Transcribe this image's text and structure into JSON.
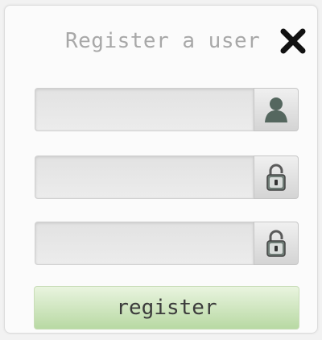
{
  "dialog": {
    "title": "Register a user",
    "close_icon": "close-icon"
  },
  "fields": {
    "username": {
      "value": "",
      "placeholder": "",
      "icon": "user-icon"
    },
    "password": {
      "value": "",
      "placeholder": "",
      "icon": "lock-icon"
    },
    "confirm_password": {
      "value": "",
      "placeholder": "",
      "icon": "lock-icon"
    }
  },
  "actions": {
    "register_label": "register"
  },
  "colors": {
    "title": "#a8a8a8",
    "button_top": "#e9f4df",
    "button_bottom": "#b8d9a3",
    "icon": "#5a6a63"
  }
}
